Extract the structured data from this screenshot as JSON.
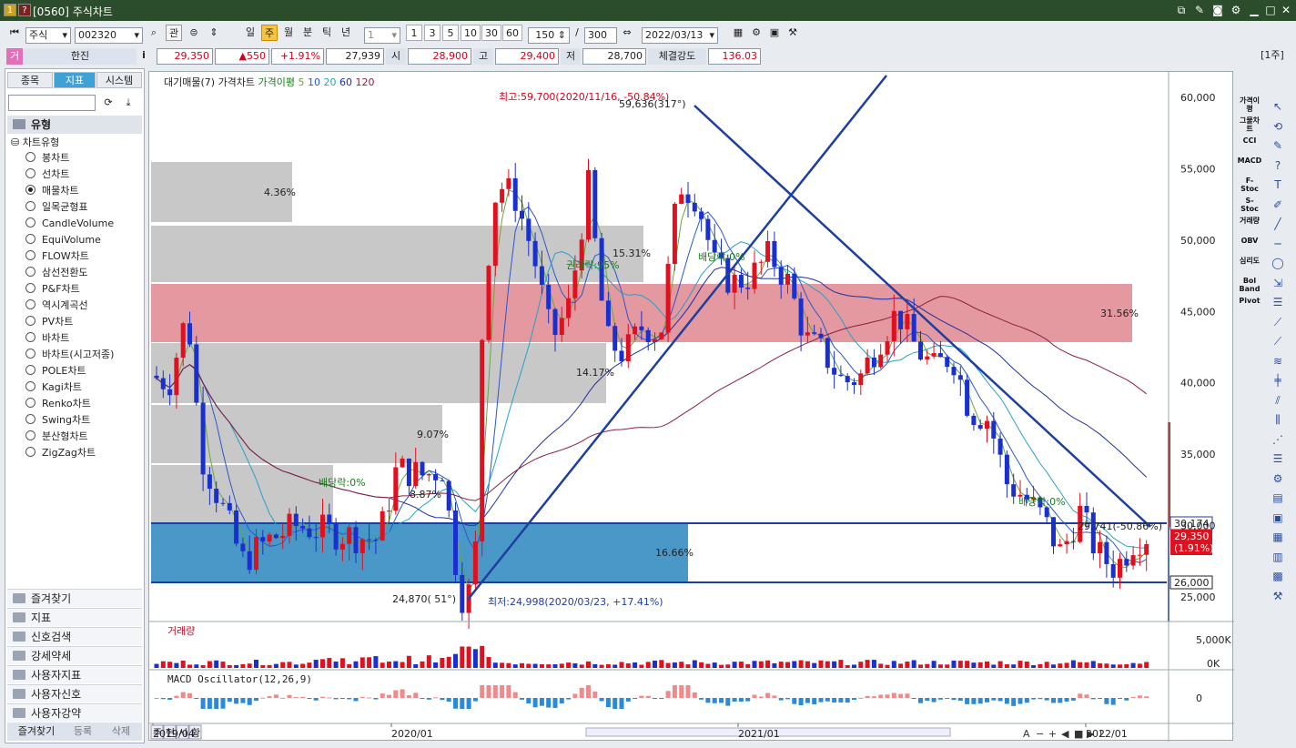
{
  "window": {
    "icon1": "1",
    "icon2": "?",
    "title": "[0560] 주식차트"
  },
  "toolbar": {
    "market": "주식",
    "code": "002320",
    "btn_gwan": "관",
    "periods": [
      "일",
      "주",
      "월",
      "분",
      "틱",
      "년"
    ],
    "active_period": "주",
    "interval": "1",
    "quick": [
      "1",
      "3",
      "5",
      "10",
      "30",
      "60"
    ],
    "count": "150",
    "slash": "/",
    "total": "300",
    "date": "2022/03/13"
  },
  "quote": {
    "name": "한진",
    "price": "29,350",
    "change": "▲550",
    "rate": "+1.91%",
    "volume": "27,939",
    "open_label": "시",
    "open": "28,900",
    "high_label": "고",
    "high": "29,400",
    "low_label": "저",
    "low": "28,700",
    "strength_label": "체결강도",
    "strength": "136.03",
    "unit": "[1주]",
    "badge": "거"
  },
  "left_panel": {
    "tabs": [
      "종목",
      "지표",
      "시스템"
    ],
    "active_tab": "지표",
    "section": "유형",
    "subsection": "차트유형",
    "chart_types": [
      "봉차트",
      "선차트",
      "매물차트",
      "일목균형표",
      "CandleVolume",
      "EquiVolume",
      "FLOW차트",
      "삼선전환도",
      "P&F차트",
      "역시계곡선",
      "PV차트",
      "바차트",
      "바차트(시고저종)",
      "POLE차트",
      "Kagi차트",
      "Renko차트",
      "Swing차트",
      "분산형차트",
      "ZigZag차트"
    ],
    "selected_type": "매물차트",
    "accordion": [
      "즐겨찾기",
      "지표",
      "신호검색",
      "강세약세",
      "사용자지표",
      "사용자신호",
      "사용자강약"
    ],
    "bottom_tabs": [
      "즐겨찾기",
      "등록",
      "삭제"
    ]
  },
  "chart": {
    "legend": {
      "price": "대기매물(7)",
      "kind": "가격차트",
      "ma_label": "가격이평",
      "ma_periods": [
        "5",
        "10",
        "20",
        "60",
        "120"
      ]
    },
    "ma_colors": [
      "#6aa83a",
      "#2a58c8",
      "#28a0c8",
      "#1f2fa0",
      "#8a2040"
    ],
    "y_ticks": [
      "60,000",
      "55,000",
      "50,000",
      "45,000",
      "40,000",
      "35,000",
      "30,000",
      "25,000"
    ],
    "x_ticks": [
      "2019/04",
      "2020/01",
      "2021/01",
      "2022/01"
    ],
    "annotations": {
      "high": "최고:59,700(2020/11/16, -50.84%)",
      "high_angle": "59,636(317°)",
      "low": "최저:24,998(2020/03/23, +17.41%)",
      "low_angle": "24,870( 51°)",
      "dividend1": "배당락:0%",
      "dividend2": "배당락:0%",
      "dividend3": "배당락:0%",
      "rights": "권리락:95%",
      "pct_1531": "15.31%",
      "pct_1417": "14.17%",
      "pct_907": "9.07%",
      "pct_887": "8.87%",
      "pct_436": "4.36%",
      "pct_3156": "31.56%",
      "pct_1666": "16.66%",
      "trend": "29,741(-50.86%)"
    },
    "tags": {
      "level1": "30,174",
      "price": "29,350",
      "rate": "(1.91%)",
      "level2": "26,000"
    },
    "volume": {
      "title": "거래량",
      "ticks": [
        "5,000K",
        "0K"
      ]
    },
    "macd": {
      "title": "MACD Oscillator(12,26,9)",
      "ticks": [
        "0"
      ]
    },
    "bottom_tabs": [
      "주",
      "현",
      "시",
      "황"
    ],
    "bottom_icons": [
      "A",
      "−",
      "+",
      "◀",
      "■",
      "▶",
      "L"
    ]
  },
  "right_indicators": [
    "가격이평",
    "그물차트",
    "CCI",
    "MACD",
    "F-Stoc",
    "S-Stoc",
    "거래량",
    "OBV",
    "심리도",
    "Bol Band",
    "Pivot"
  ]
}
